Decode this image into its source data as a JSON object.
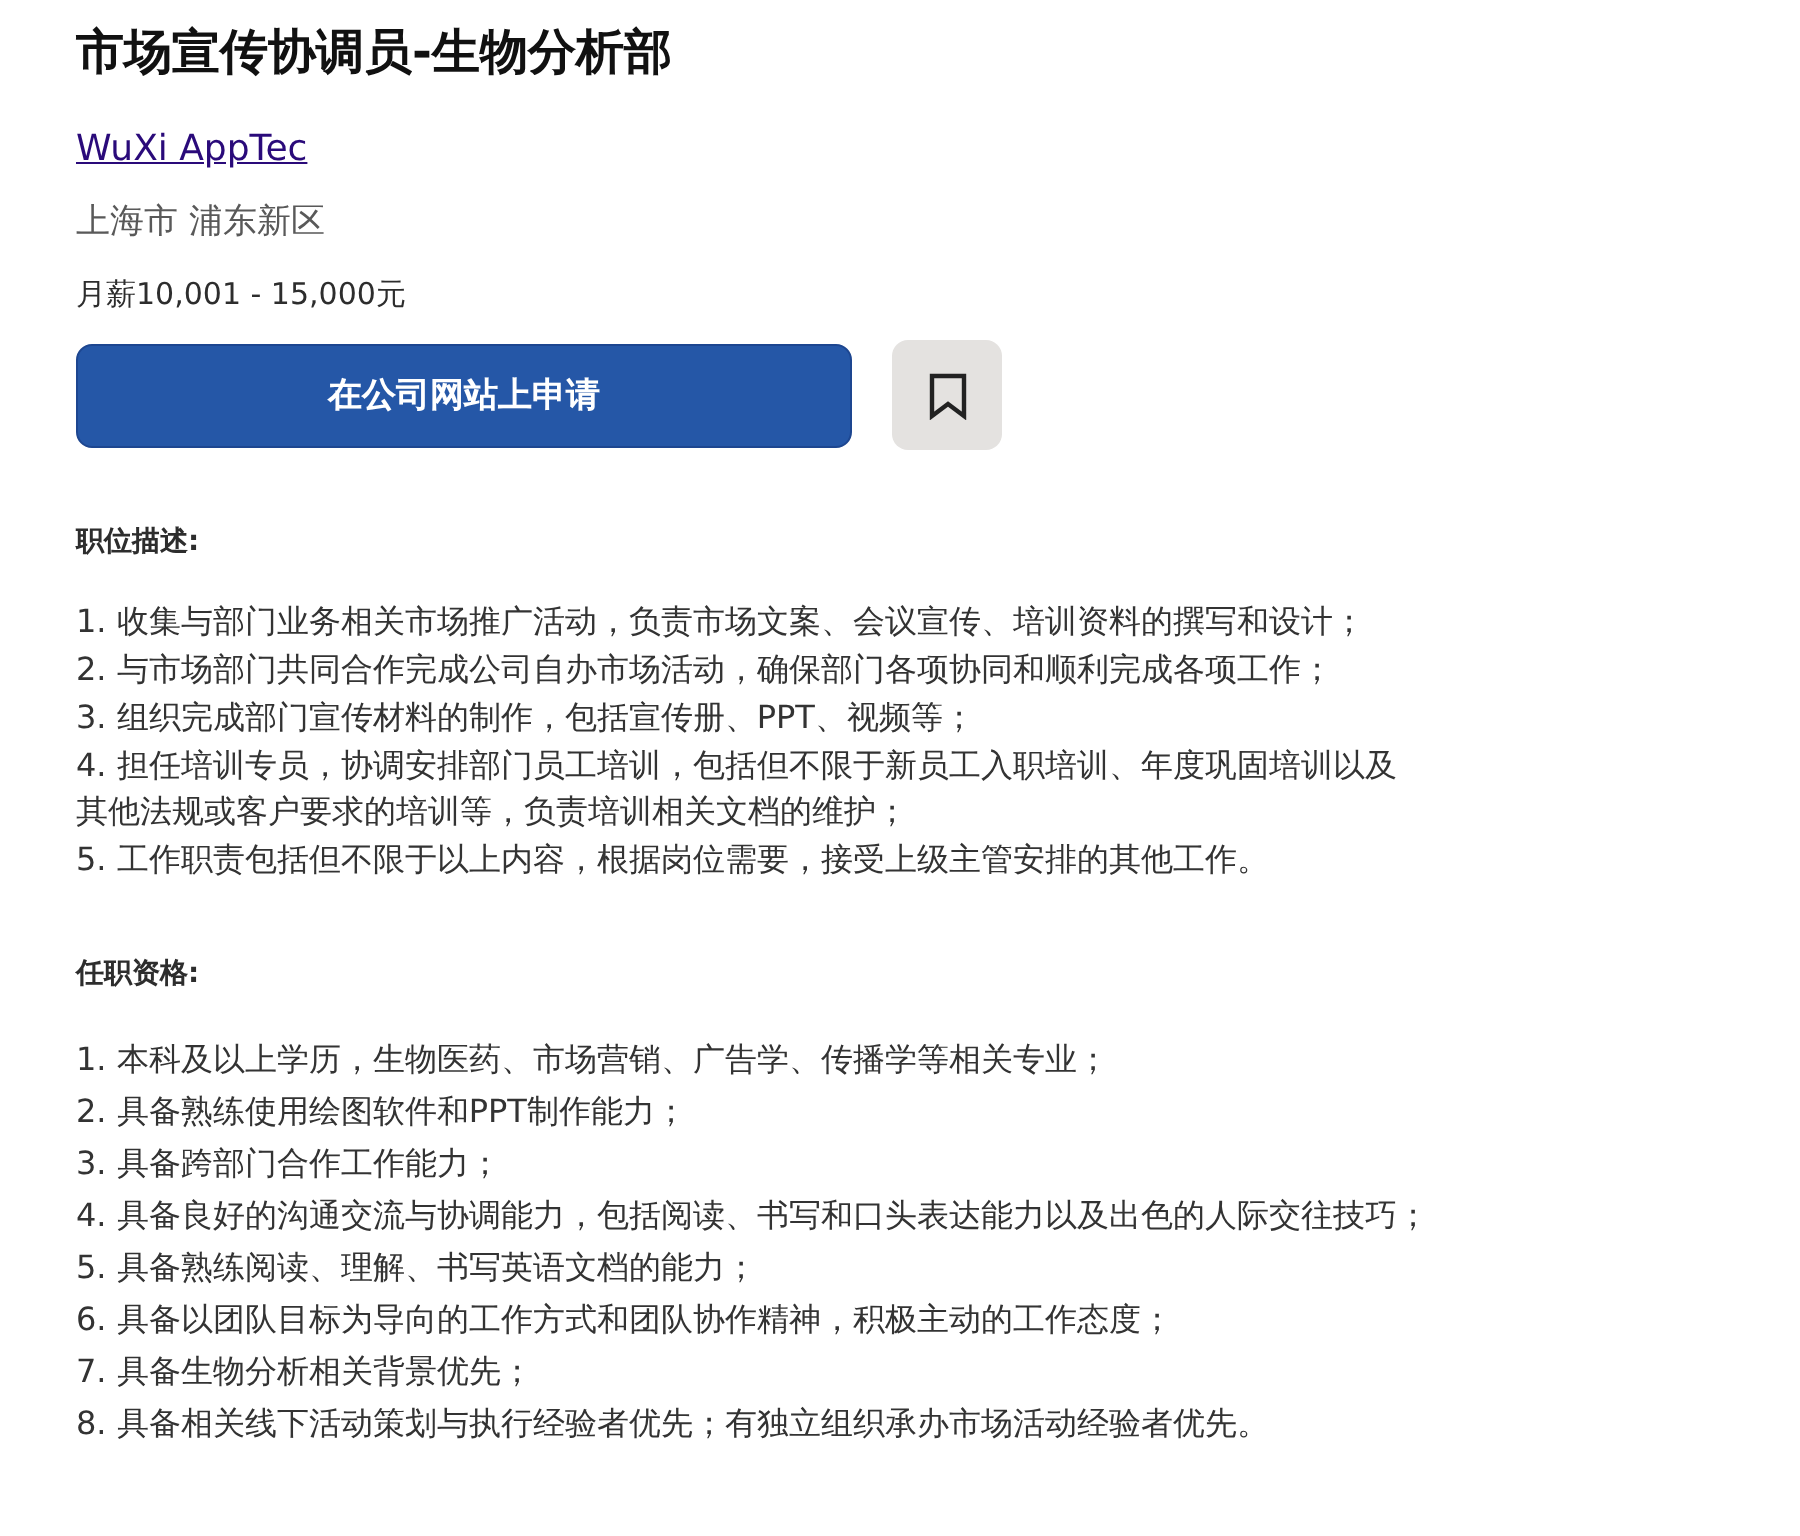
{
  "job": {
    "title": "市场宣传协调员-生物分析部",
    "company": "WuXi AppTec",
    "location": "上海市 浦东新区",
    "salary": "月薪10,001 - 15,000元",
    "apply_button": "在公司网站上申请",
    "saved": false
  },
  "description": {
    "heading": "职位描述:",
    "items": [
      "1. 收集与部门业务相关市场推广活动，负责市场文案、会议宣传、培训资料的撰写和设计；",
      "2. 与市场部门共同合作完成公司自办市场活动，确保部门各项协同和顺利完成各项工作；",
      "3. 组织完成部门宣传材料的制作，包括宣传册、PPT、视频等；",
      "4. 担任培训专员，协调安排部门员工培训，包括但不限于新员工入职培训、年度巩固培训以及其他法规或客户要求的培训等，负责培训相关文档的维护；",
      "5. 工作职责包括但不限于以上内容，根据岗位需要，接受上级主管安排的其他工作。"
    ]
  },
  "requirements": {
    "heading": "任职资格:",
    "items": [
      "1. 本科及以上学历，生物医药、市场营销、广告学、传播学等相关专业；",
      "2. 具备熟练使用绘图软件和PPT制作能力；",
      "3. 具备跨部门合作工作能力；",
      "4. 具备良好的沟通交流与协调能力，包括阅读、书写和口头表达能力以及出色的人际交往技巧；",
      "5. 具备熟练阅读、理解、书写英语文档的能力；",
      "6. 具备以团队目标为导向的工作方式和团队协作精神，积极主动的工作态度；",
      "7. 具备生物分析相关背景优先；",
      "8. 具备相关线下活动策划与执行经验者优先；有独立组织承办市场活动经验者优先。"
    ]
  }
}
